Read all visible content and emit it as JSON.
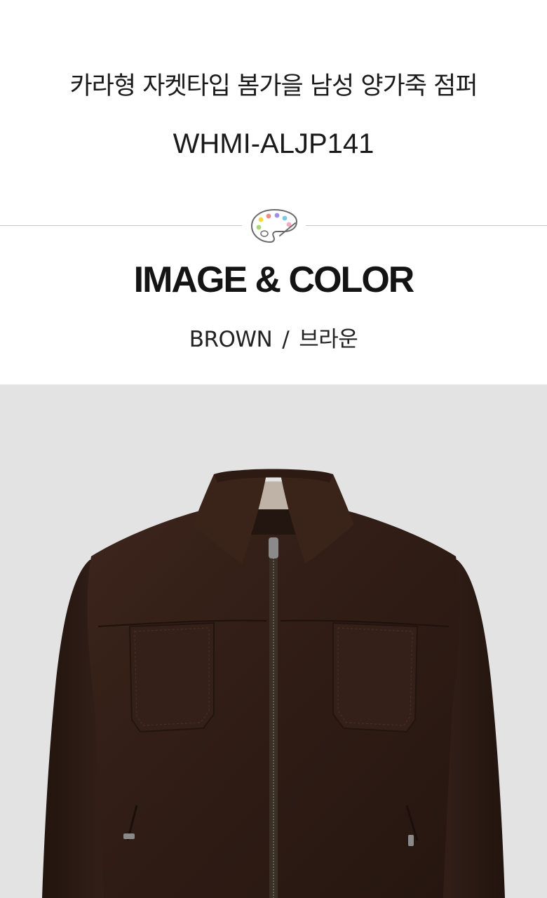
{
  "product": {
    "title": "카라형 자켓타입 봄가을 남성 양가죽 점퍼",
    "code": "WHMI-ALJP141"
  },
  "section": {
    "title": "IMAGE & COLOR",
    "icon": "palette-icon"
  },
  "color": {
    "english": "BROWN",
    "separator": "/",
    "korean": "브라운",
    "swatch": "#3a241c"
  },
  "colors": {
    "background_photo": "#e3e3e3",
    "divider": "#c9c9c9",
    "palette_dots": [
      "#f5d742",
      "#f28b82",
      "#7ec8e3",
      "#9b8fe8",
      "#a6d96a",
      "#f7a8c4"
    ]
  }
}
